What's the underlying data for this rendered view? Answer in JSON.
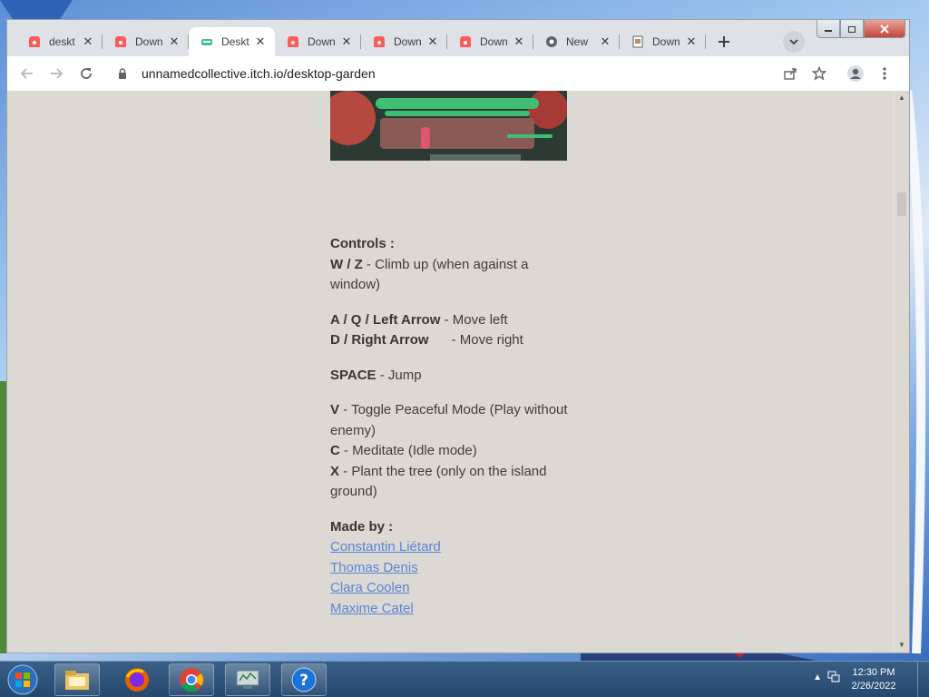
{
  "browser": {
    "tabs": [
      {
        "title": "deskt",
        "icon": "itch-icon",
        "active": false
      },
      {
        "title": "Down",
        "icon": "itch-icon",
        "active": false
      },
      {
        "title": "Deskt",
        "icon": "game-icon",
        "active": true
      },
      {
        "title": "Down",
        "icon": "itch-icon",
        "active": false
      },
      {
        "title": "Down",
        "icon": "itch-icon",
        "active": false
      },
      {
        "title": "Down",
        "icon": "itch-icon",
        "active": false
      },
      {
        "title": "New",
        "icon": "chrome-icon",
        "active": false
      },
      {
        "title": "Down",
        "icon": "file-icon",
        "active": false
      }
    ],
    "url": "unnamedcollective.itch.io/desktop-garden"
  },
  "page": {
    "controls_heading": "Controls :",
    "controls": [
      {
        "key": "W / Z",
        "desc": " - Climb up (when against a window)"
      },
      {
        "key": "A / Q / Left Arrow",
        "desc": " - Move left"
      },
      {
        "key": "D / Right Arrow",
        "desc": "      - Move right"
      },
      {
        "key": "SPACE",
        "desc": " - Jump"
      },
      {
        "key": "V",
        "desc": " - Toggle Peaceful Mode (Play without enemy)"
      },
      {
        "key": "C",
        "desc": " - Meditate (Idle mode)"
      },
      {
        "key": "X",
        "desc": " - Plant the tree (only on the island ground)"
      }
    ],
    "made_by_heading": "Made by :",
    "authors": [
      "Constantin Liétard",
      "Thomas Denis",
      "Clara Coolen",
      "Maxime Catel"
    ]
  },
  "taskbar": {
    "time": "12:30 PM",
    "date": "2/26/2022",
    "apps": [
      "explorer-icon",
      "firefox-icon",
      "chrome-icon",
      "monitor-icon",
      "help-icon"
    ]
  },
  "colors": {
    "link": "#5a86d6",
    "page_bg": "#dcd9d4",
    "text": "#403d3a"
  }
}
